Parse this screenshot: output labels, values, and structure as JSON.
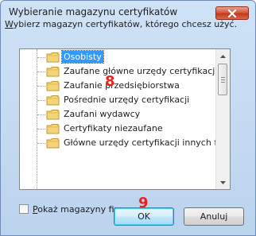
{
  "window": {
    "title": "Wybieranie magazynu certyfikatów"
  },
  "instruction": {
    "underlined_letter": "W",
    "rest": "ybierz magazyn certyfikatów, którego chcesz użyć."
  },
  "tree": {
    "items": [
      {
        "label": "Osobisty",
        "selected": true
      },
      {
        "label": "Zaufane główne urzędy certyfikacji",
        "selected": false
      },
      {
        "label": "Zaufanie przedsiębiorstwa",
        "selected": false
      },
      {
        "label": "Pośrednie urzędy certyfikacji",
        "selected": false
      },
      {
        "label": "Zaufani wydawcy",
        "selected": false
      },
      {
        "label": "Certyfikaty niezaufane",
        "selected": false
      },
      {
        "label": "Główne urzędy certyfikacji innych firm",
        "selected": false
      }
    ]
  },
  "checkbox": {
    "underlined_letter": "P",
    "rest": "okaż magazyny fizyczne",
    "checked": false
  },
  "buttons": {
    "ok": "OK",
    "cancel": "Anuluj"
  },
  "markers": {
    "step_8": "8",
    "step_9": "9"
  },
  "colors": {
    "selection": "#3399ff",
    "marker": "#e8231b",
    "close_button": "#c3381f"
  },
  "icons": {
    "close": "close-icon",
    "folder": "folder-icon",
    "scroll_up": "scroll-up-arrow-icon",
    "scroll_down": "scroll-down-arrow-icon"
  }
}
